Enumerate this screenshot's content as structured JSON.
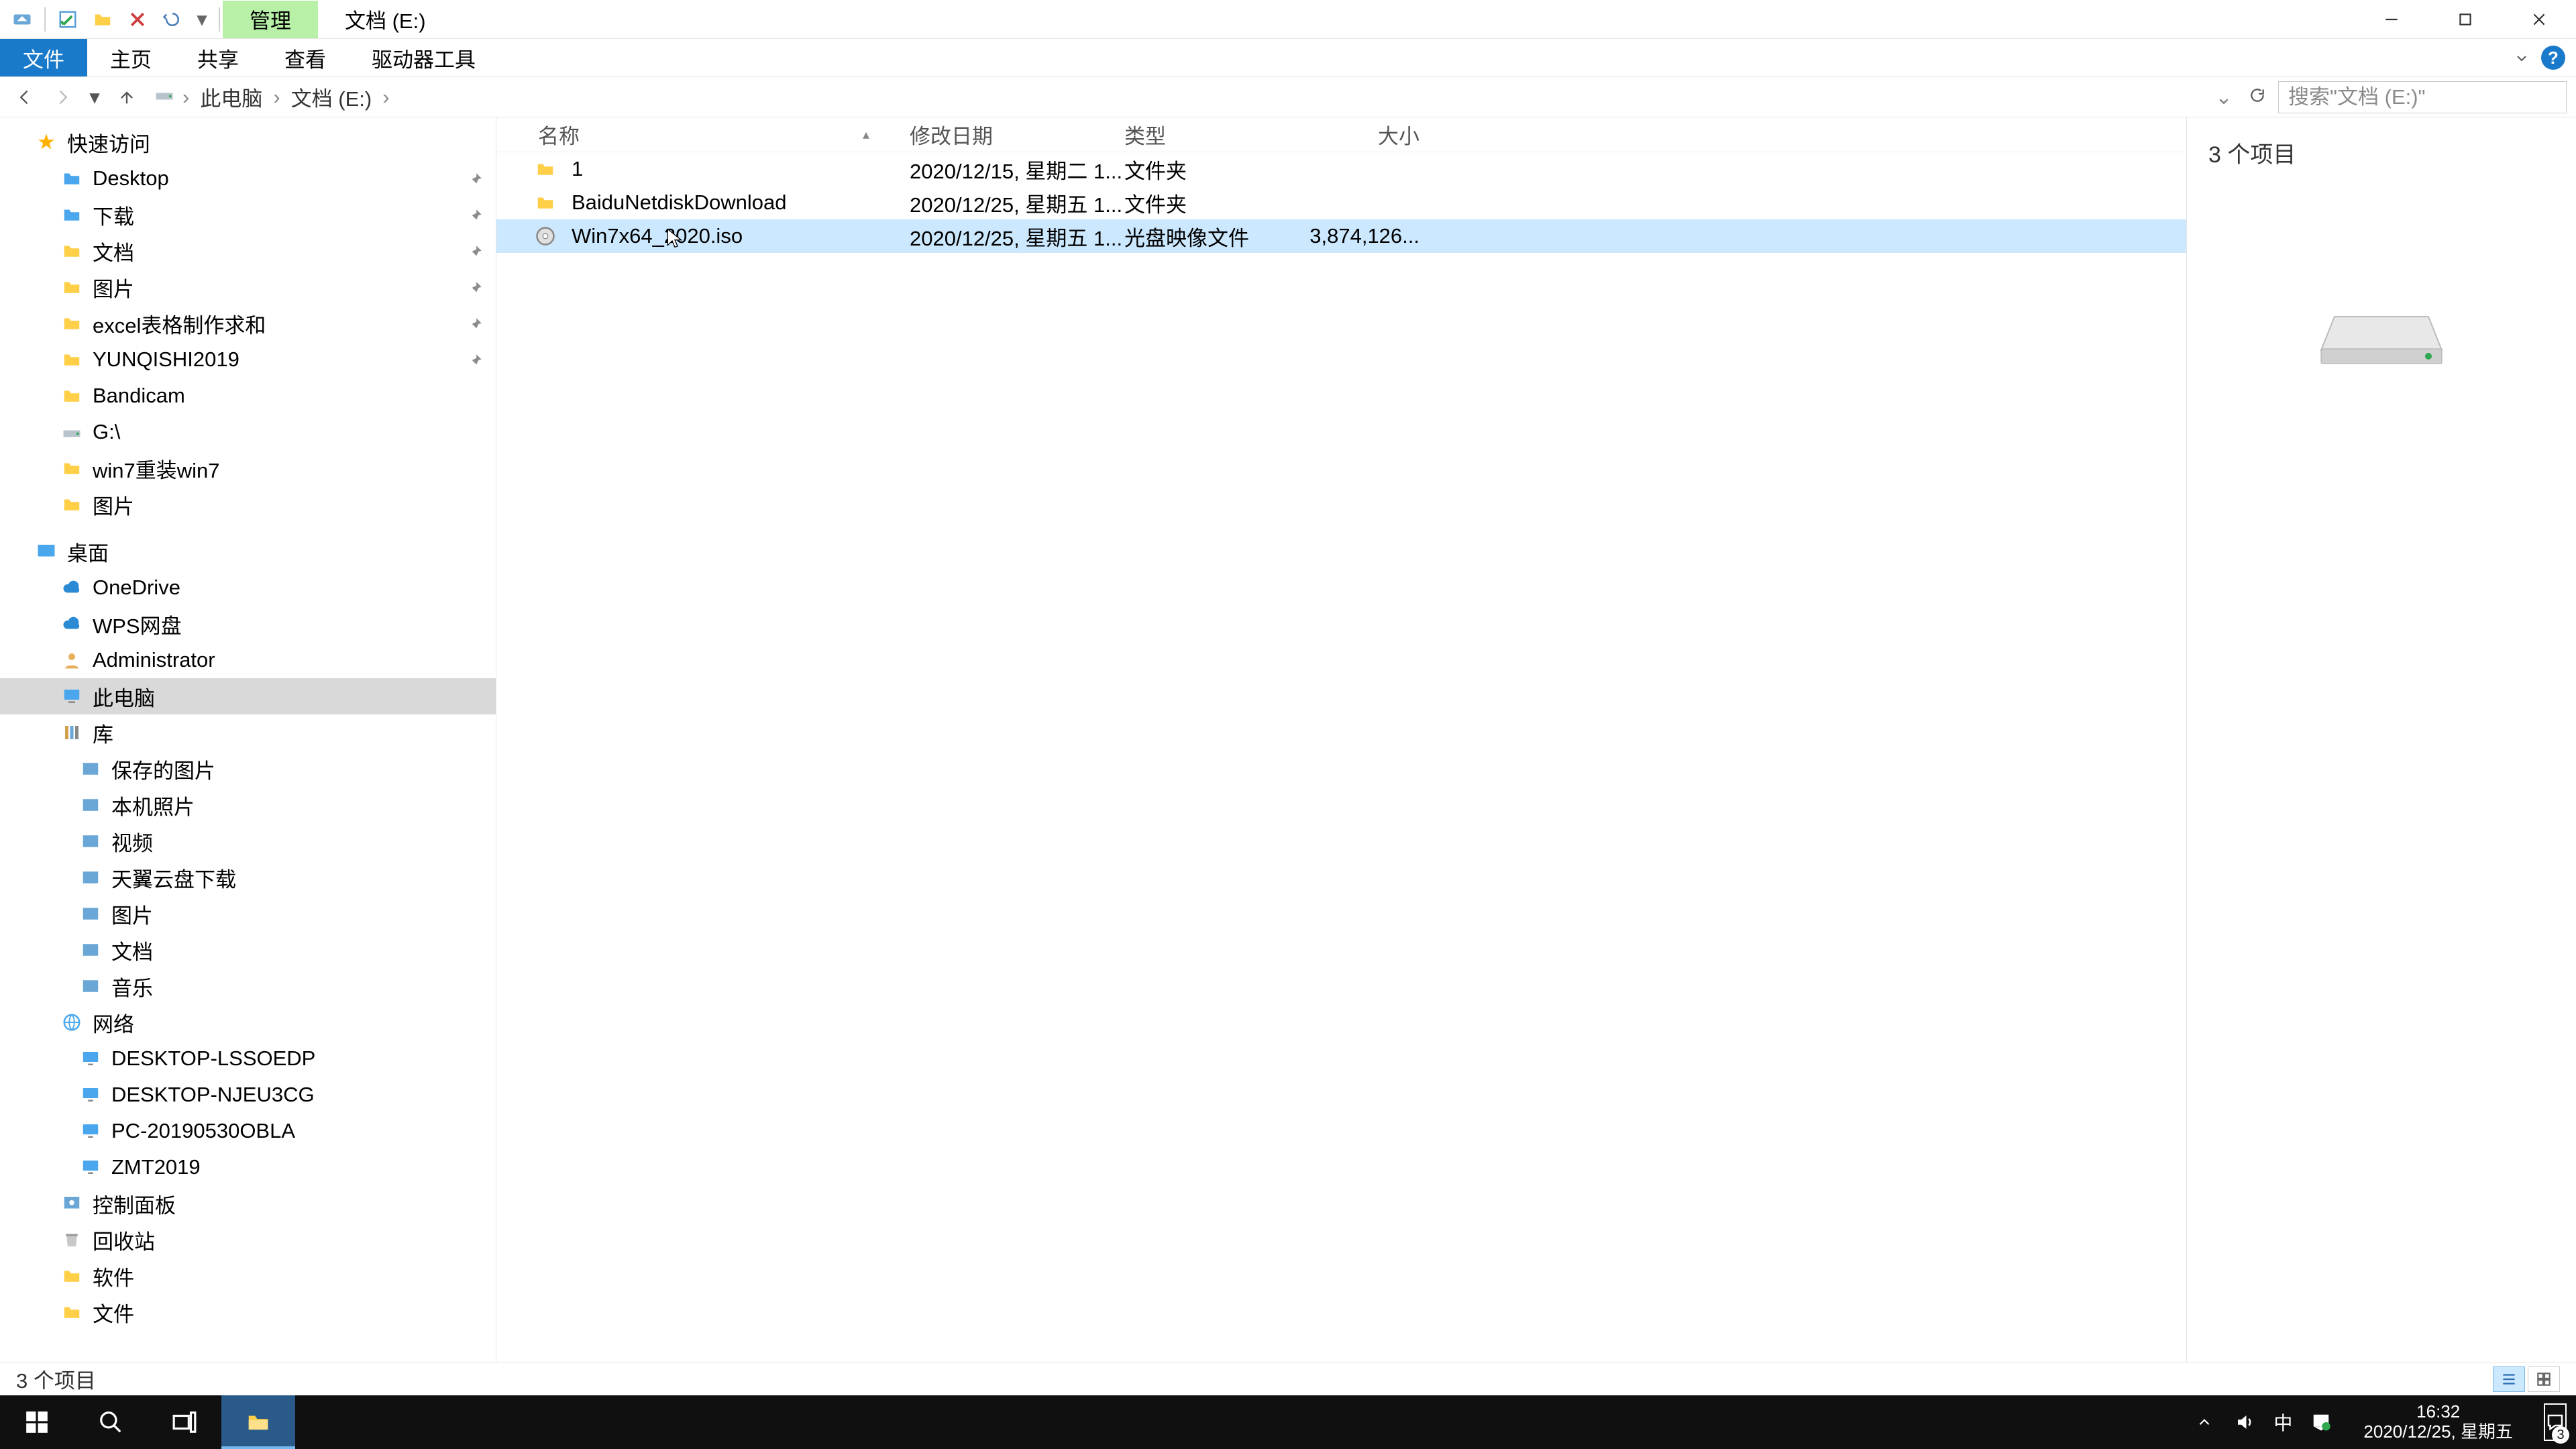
{
  "titlebar": {
    "contextual_tab": "管理",
    "title_tab": "文档 (E:)"
  },
  "ribbon": {
    "tabs": [
      "文件",
      "主页",
      "共享",
      "查看",
      "驱动器工具"
    ]
  },
  "breadcrumb": {
    "items": [
      "此电脑",
      "文档 (E:)"
    ]
  },
  "search": {
    "placeholder": "搜索\"文档 (E:)\""
  },
  "nav": {
    "quick_access": "快速访问",
    "quick_items": [
      {
        "label": "Desktop",
        "pinned": true,
        "icon": "folder-blue"
      },
      {
        "label": "下载",
        "pinned": true,
        "icon": "folder-blue"
      },
      {
        "label": "文档",
        "pinned": true,
        "icon": "folder-yellow"
      },
      {
        "label": "图片",
        "pinned": true,
        "icon": "folder-yellow"
      },
      {
        "label": "excel表格制作求和",
        "pinned": true,
        "icon": "folder-yellow"
      },
      {
        "label": "YUNQISHI2019",
        "pinned": true,
        "icon": "folder-yellow"
      },
      {
        "label": "Bandicam",
        "pinned": false,
        "icon": "folder-yellow"
      },
      {
        "label": "G:\\",
        "pinned": false,
        "icon": "drive"
      },
      {
        "label": "win7重装win7",
        "pinned": false,
        "icon": "folder-yellow"
      },
      {
        "label": "图片",
        "pinned": false,
        "icon": "folder-yellow"
      }
    ],
    "desktop": "桌面",
    "desktop_items": [
      {
        "label": "OneDrive",
        "icon": "cloud-blue"
      },
      {
        "label": "WPS网盘",
        "icon": "cloud-blue"
      },
      {
        "label": "Administrator",
        "icon": "user"
      },
      {
        "label": "此电脑",
        "icon": "computer",
        "selected": true
      },
      {
        "label": "库",
        "icon": "library"
      }
    ],
    "library_items": [
      {
        "label": "保存的图片"
      },
      {
        "label": "本机照片"
      },
      {
        "label": "视频"
      },
      {
        "label": "天翼云盘下载"
      },
      {
        "label": "图片"
      },
      {
        "label": "文档"
      },
      {
        "label": "音乐"
      }
    ],
    "network": "网络",
    "network_items": [
      {
        "label": "DESKTOP-LSSOEDP"
      },
      {
        "label": "DESKTOP-NJEU3CG"
      },
      {
        "label": "PC-20190530OBLA"
      },
      {
        "label": "ZMT2019"
      }
    ],
    "tail": [
      {
        "label": "控制面板",
        "icon": "control-panel"
      },
      {
        "label": "回收站",
        "icon": "recycle"
      },
      {
        "label": "软件",
        "icon": "folder-yellow"
      },
      {
        "label": "文件",
        "icon": "folder-yellow"
      }
    ]
  },
  "columns": {
    "name": "名称",
    "date": "修改日期",
    "type": "类型",
    "size": "大小"
  },
  "files": [
    {
      "name": "1",
      "date": "2020/12/15, 星期二 1...",
      "type": "文件夹",
      "size": "",
      "icon": "folder",
      "selected": false
    },
    {
      "name": "BaiduNetdiskDownload",
      "date": "2020/12/25, 星期五 1...",
      "type": "文件夹",
      "size": "",
      "icon": "folder",
      "selected": false
    },
    {
      "name": "Win7x64_2020.iso",
      "date": "2020/12/25, 星期五 1...",
      "type": "光盘映像文件",
      "size": "3,874,126...",
      "icon": "disc",
      "selected": true
    }
  ],
  "details": {
    "count_label": "3 个项目"
  },
  "statusbar": {
    "text": "3 个项目"
  },
  "taskbar": {
    "clock": {
      "time": "16:32",
      "date": "2020/12/25, 星期五"
    },
    "notif_badge": "3",
    "ime": "中"
  }
}
